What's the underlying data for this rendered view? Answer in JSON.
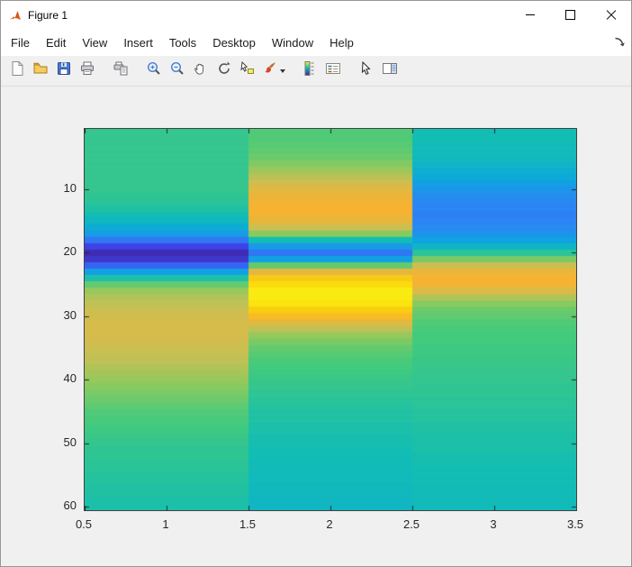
{
  "window": {
    "title": "Figure 1"
  },
  "menu": {
    "items": [
      "File",
      "Edit",
      "View",
      "Insert",
      "Tools",
      "Desktop",
      "Window",
      "Help"
    ]
  },
  "toolbar": {
    "buttons": [
      {
        "name": "new-figure",
        "label": "New Figure"
      },
      {
        "name": "open-file",
        "label": "Open File"
      },
      {
        "name": "save-figure",
        "label": "Save Figure"
      },
      {
        "name": "print-figure",
        "label": "Print Figure"
      },
      {
        "name": "print-preview",
        "label": "Print Preview"
      },
      {
        "name": "zoom-in",
        "label": "Zoom In"
      },
      {
        "name": "zoom-out",
        "label": "Zoom Out"
      },
      {
        "name": "pan",
        "label": "Pan"
      },
      {
        "name": "rotate-3d",
        "label": "Rotate 3D"
      },
      {
        "name": "data-cursor",
        "label": "Data Cursor"
      },
      {
        "name": "brush",
        "label": "Brush/Select Data"
      },
      {
        "name": "insert-colorbar",
        "label": "Insert Colorbar"
      },
      {
        "name": "insert-legend",
        "label": "Insert Legend"
      },
      {
        "name": "edit-plot",
        "label": "Edit Plot"
      },
      {
        "name": "show-plot-tools",
        "label": "Show Plot Tools and Dock Figure"
      }
    ]
  },
  "colors": {
    "figure_background": "#f0f0f0",
    "axes_border": "#414141",
    "tick_color": "#262626",
    "titlebar_background": "#ffffff"
  },
  "chart_data": {
    "type": "heatmap",
    "title": "",
    "xlabel": "",
    "ylabel": "",
    "colormap": "parula",
    "x_range": [
      0.5,
      3.5
    ],
    "y_range": [
      0.5,
      60.5
    ],
    "x_ticks": [
      0.5,
      1,
      1.5,
      2,
      2.5,
      3,
      3.5
    ],
    "y_ticks": [
      10,
      20,
      30,
      40,
      50,
      60
    ],
    "rows": 60,
    "cols": 3,
    "colormap_stops": [
      [
        0.0,
        62,
        38,
        168
      ],
      [
        0.12,
        63,
        72,
        240
      ],
      [
        0.25,
        44,
        133,
        244
      ],
      [
        0.37,
        12,
        167,
        223
      ],
      [
        0.5,
        18,
        189,
        180
      ],
      [
        0.6,
        66,
        202,
        125
      ],
      [
        0.7,
        136,
        202,
        95
      ],
      [
        0.8,
        204,
        191,
        82
      ],
      [
        0.88,
        246,
        178,
        48
      ],
      [
        0.95,
        250,
        211,
        10
      ],
      [
        1.0,
        249,
        251,
        21
      ]
    ],
    "values": [
      [
        0.57,
        0.62,
        0.5
      ],
      [
        0.57,
        0.62,
        0.5
      ],
      [
        0.57,
        0.63,
        0.49
      ],
      [
        0.57,
        0.64,
        0.48
      ],
      [
        0.57,
        0.66,
        0.47
      ],
      [
        0.57,
        0.69,
        0.45
      ],
      [
        0.57,
        0.73,
        0.42
      ],
      [
        0.57,
        0.77,
        0.39
      ],
      [
        0.57,
        0.81,
        0.35
      ],
      [
        0.57,
        0.84,
        0.31
      ],
      [
        0.56,
        0.86,
        0.28
      ],
      [
        0.55,
        0.87,
        0.26
      ],
      [
        0.53,
        0.88,
        0.25
      ],
      [
        0.5,
        0.87,
        0.24
      ],
      [
        0.46,
        0.85,
        0.25
      ],
      [
        0.4,
        0.8,
        0.27
      ],
      [
        0.33,
        0.7,
        0.3
      ],
      [
        0.22,
        0.5,
        0.36
      ],
      [
        0.1,
        0.32,
        0.45
      ],
      [
        0.02,
        0.22,
        0.55
      ],
      [
        0.06,
        0.35,
        0.68
      ],
      [
        0.18,
        0.65,
        0.8
      ],
      [
        0.35,
        0.85,
        0.86
      ],
      [
        0.52,
        0.93,
        0.88
      ],
      [
        0.65,
        0.96,
        0.87
      ],
      [
        0.72,
        0.98,
        0.83
      ],
      [
        0.76,
        0.98,
        0.76
      ],
      [
        0.78,
        0.97,
        0.7
      ],
      [
        0.8,
        0.94,
        0.66
      ],
      [
        0.81,
        0.9,
        0.64
      ],
      [
        0.82,
        0.84,
        0.62
      ],
      [
        0.82,
        0.78,
        0.61
      ],
      [
        0.82,
        0.72,
        0.6
      ],
      [
        0.81,
        0.68,
        0.6
      ],
      [
        0.8,
        0.65,
        0.59
      ],
      [
        0.79,
        0.63,
        0.59
      ],
      [
        0.78,
        0.61,
        0.58
      ],
      [
        0.76,
        0.6,
        0.58
      ],
      [
        0.74,
        0.59,
        0.57
      ],
      [
        0.72,
        0.58,
        0.57
      ],
      [
        0.7,
        0.57,
        0.56
      ],
      [
        0.68,
        0.56,
        0.56
      ],
      [
        0.66,
        0.55,
        0.55
      ],
      [
        0.64,
        0.54,
        0.55
      ],
      [
        0.62,
        0.53,
        0.54
      ],
      [
        0.61,
        0.53,
        0.54
      ],
      [
        0.6,
        0.52,
        0.53
      ],
      [
        0.59,
        0.52,
        0.53
      ],
      [
        0.58,
        0.51,
        0.52
      ],
      [
        0.57,
        0.51,
        0.52
      ],
      [
        0.56,
        0.5,
        0.52
      ],
      [
        0.56,
        0.5,
        0.51
      ],
      [
        0.55,
        0.49,
        0.51
      ],
      [
        0.55,
        0.49,
        0.5
      ],
      [
        0.54,
        0.48,
        0.5
      ],
      [
        0.54,
        0.48,
        0.5
      ],
      [
        0.53,
        0.47,
        0.49
      ],
      [
        0.53,
        0.47,
        0.49
      ],
      [
        0.52,
        0.46,
        0.49
      ],
      [
        0.52,
        0.46,
        0.48
      ]
    ]
  }
}
